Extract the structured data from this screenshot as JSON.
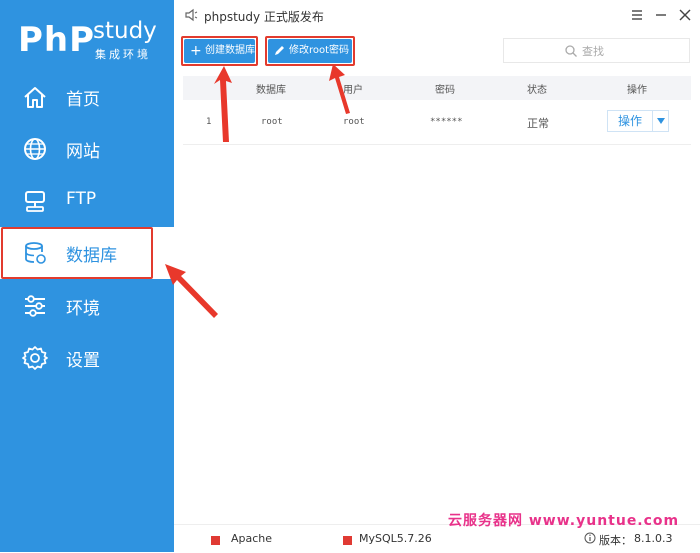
{
  "app": {
    "logo_php": "PhP",
    "logo_study": "study",
    "logo_subtitle": "集成环境",
    "window_title": "phpstudy 正式版发布"
  },
  "sidebar": {
    "items": [
      {
        "label": "首页",
        "icon": "home-icon"
      },
      {
        "label": "网站",
        "icon": "globe-icon"
      },
      {
        "label": "FTP",
        "icon": "server-icon"
      },
      {
        "label": "数据库",
        "icon": "database-icon",
        "active": true
      },
      {
        "label": "环境",
        "icon": "sliders-icon"
      },
      {
        "label": "设置",
        "icon": "gear-icon"
      }
    ]
  },
  "toolbar": {
    "create_db_label": "创建数据库",
    "change_root_pw_label": "修改root密码",
    "search_placeholder": "查找"
  },
  "table": {
    "headers": [
      "数据库",
      "用户",
      "密码",
      "状态",
      "操作"
    ],
    "rows": [
      {
        "index": "1",
        "database": "root",
        "user": "root",
        "password": "******",
        "status": "正常",
        "action": "操作"
      }
    ]
  },
  "statusbar": {
    "services": [
      {
        "name": "Apache",
        "color": "#e03a33"
      },
      {
        "name": "MySQL5.7.26",
        "color": "#e03a33"
      }
    ],
    "version_label": "版本：",
    "version": "8.1.0.3"
  },
  "watermark": "云服务器网 www.yuntue.com",
  "colors": {
    "accent": "#2f93e0",
    "highlight": "#e23b2e"
  }
}
